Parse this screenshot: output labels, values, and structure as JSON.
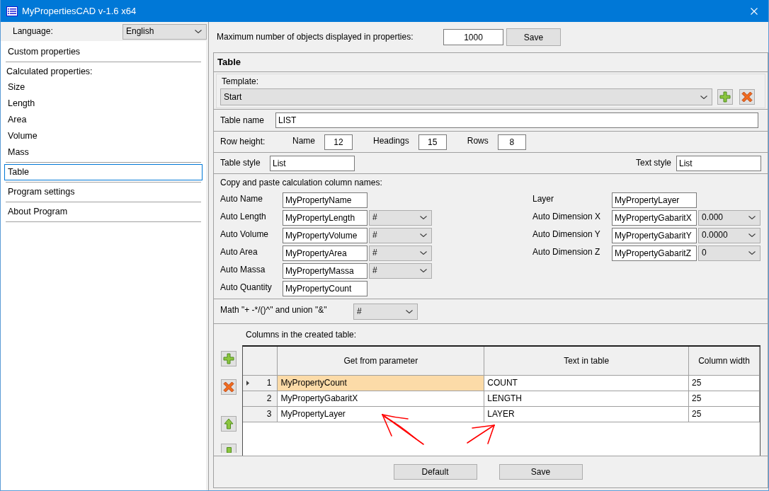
{
  "window": {
    "title": "MyPropertiesCAD v-1.6 x64"
  },
  "sidebar": {
    "language_label": "Language:",
    "language": "English",
    "groups": [
      {
        "items": [
          {
            "label": "Custom properties",
            "selected": false
          }
        ]
      },
      {
        "title": "Calculated properties:",
        "items": [
          {
            "label": "Size",
            "selected": false
          },
          {
            "label": "Length",
            "selected": false
          },
          {
            "label": "Area",
            "selected": false
          },
          {
            "label": "Volume",
            "selected": false
          },
          {
            "label": "Mass",
            "selected": false
          }
        ]
      },
      {
        "items": [
          {
            "label": "Table",
            "selected": true
          }
        ]
      },
      {
        "items": [
          {
            "label": "Program settings",
            "selected": false
          }
        ]
      },
      {
        "items": [
          {
            "label": "About Program",
            "selected": false
          }
        ]
      }
    ]
  },
  "max_objects": {
    "label": "Maximum number of objects displayed in properties:",
    "value": "1000",
    "button": "Save"
  },
  "table_settings": {
    "title": "Table",
    "template": {
      "label": "Template:",
      "value": "Start"
    },
    "table_name": {
      "label": "Table name",
      "value": "LIST"
    },
    "row_height": {
      "label": "Row height:",
      "fields": [
        {
          "label": "Name",
          "value": "12"
        },
        {
          "label": "Headings",
          "value": "15"
        },
        {
          "label": "Rows",
          "value": "8"
        }
      ]
    },
    "table_style": {
      "label": "Table style",
      "value": "List"
    },
    "text_style": {
      "label": "Text style",
      "value": "List"
    },
    "calculation_names": {
      "title": "Copy and paste calculation column names:",
      "left": [
        {
          "label": "Auto Name",
          "value": "MyPropertyName"
        },
        {
          "label": "Auto Length",
          "value": "MyPropertyLength",
          "format": "#"
        },
        {
          "label": "Auto Volume",
          "value": "MyPropertyVolume",
          "format": "#"
        },
        {
          "label": "Auto Area",
          "value": "MyPropertyArea",
          "format": "#"
        },
        {
          "label": "Auto Massa",
          "value": "MyPropertyMassa",
          "format": "#"
        },
        {
          "label": "Auto Quantity",
          "value": "MyPropertyCount"
        }
      ],
      "right": [
        {
          "label": "Layer",
          "value": "MyPropertyLayer"
        },
        {
          "label": "Auto Dimension X",
          "value": "MyPropertyGabaritX",
          "format": "0.000"
        },
        {
          "label": "Auto Dimension Y",
          "value": "MyPropertyGabaritY",
          "format": "0.0000"
        },
        {
          "label": "Auto Dimension Z",
          "value": "MyPropertyGabaritZ",
          "format": "0"
        }
      ]
    },
    "math": {
      "label": "Math \"+ -*/()^\" and union \"&\"",
      "value": "#"
    },
    "columns": {
      "title": "Columns in the created table:",
      "headers": [
        "Get from parameter",
        "Text in table",
        "Column width"
      ],
      "rows": [
        {
          "number": "1",
          "selected": true,
          "cells": [
            "MyPropertyCount",
            "COUNT",
            "25"
          ]
        },
        {
          "number": "2",
          "selected": false,
          "cells": [
            "MyPropertyGabaritX",
            "LENGTH",
            "25"
          ]
        },
        {
          "number": "3",
          "selected": false,
          "cells": [
            "MyPropertyLayer",
            "LAYER",
            "25"
          ]
        }
      ]
    },
    "buttons": [
      "Default",
      "Save"
    ]
  }
}
